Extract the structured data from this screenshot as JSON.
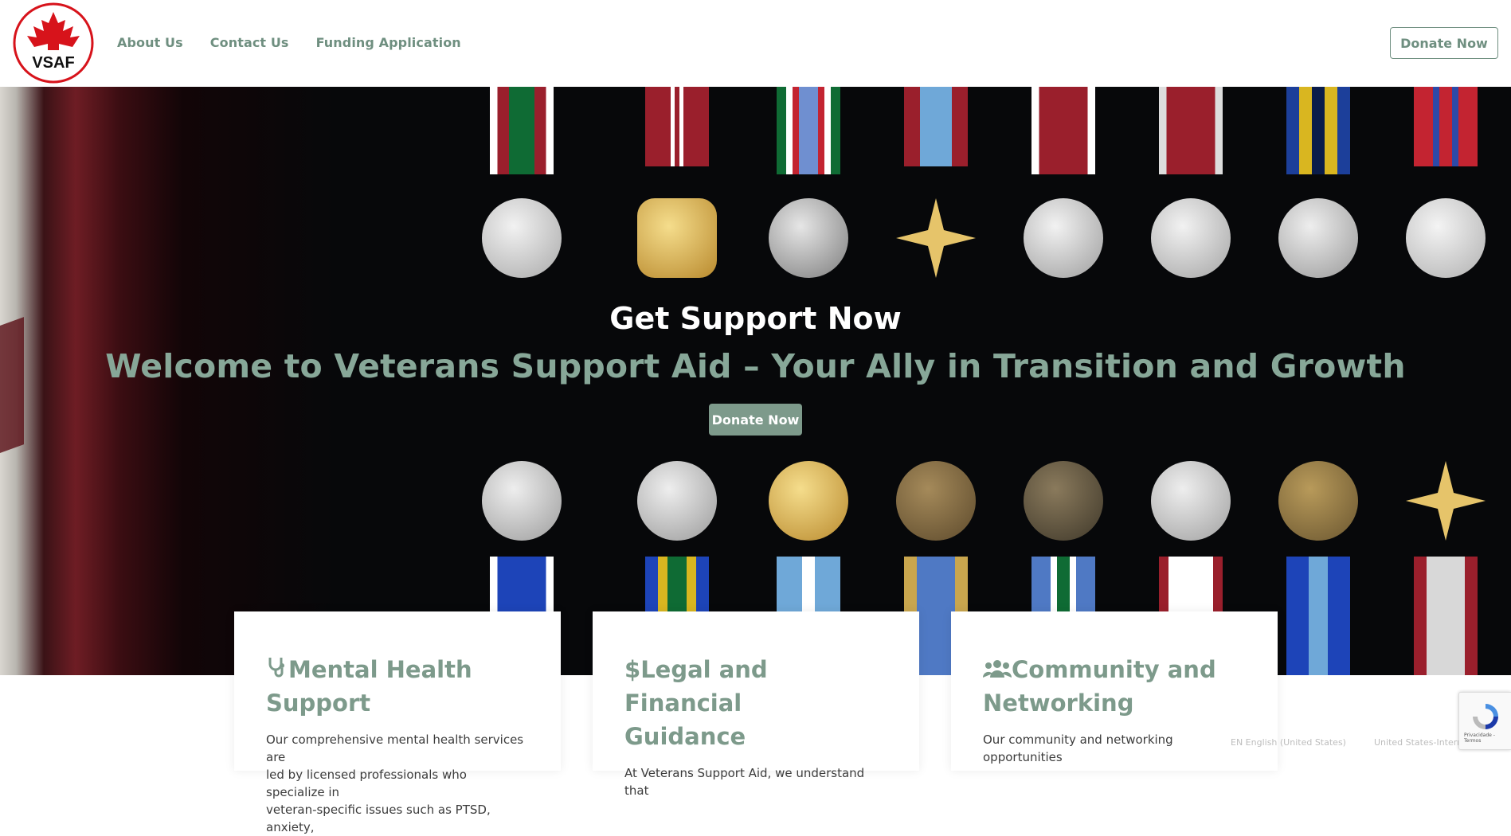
{
  "header": {
    "logo_text": "VSAF",
    "nav": [
      "About Us",
      "Contact Us",
      "Funding Application"
    ],
    "donate_label": "Donate Now"
  },
  "hero": {
    "title": "Get Support Now",
    "subtitle": "Welcome to Veterans Support Aid – Your Ally in Transition and Growth",
    "donate_label": "Donate Now"
  },
  "cards": [
    {
      "icon": "stethoscope-icon",
      "title": "Mental Health Support",
      "text_lines": [
        "Our comprehensive mental health services are",
        "led by licensed professionals who specialize in",
        "veteran-specific issues such as PTSD, anxiety,"
      ]
    },
    {
      "icon": "dollar-icon",
      "title_line1": "Legal and Financial",
      "title_line2": "Guidance",
      "text_lines": [
        "At Veterans Support Aid, we understand that"
      ]
    },
    {
      "icon": "users-icon",
      "title_line1": "Community and",
      "title_line2": "Networking",
      "text_lines": [
        "Our community and networking opportunities"
      ]
    }
  ],
  "footer": {
    "lang_left": "EN English (United States)",
    "lang_right": "United States-International"
  },
  "recaptcha": {
    "text": "Privacidade - Termos"
  },
  "colors": {
    "accent": "#7d9a8b",
    "hero_bg": "#07080a",
    "logo_red": "#d7131b"
  }
}
